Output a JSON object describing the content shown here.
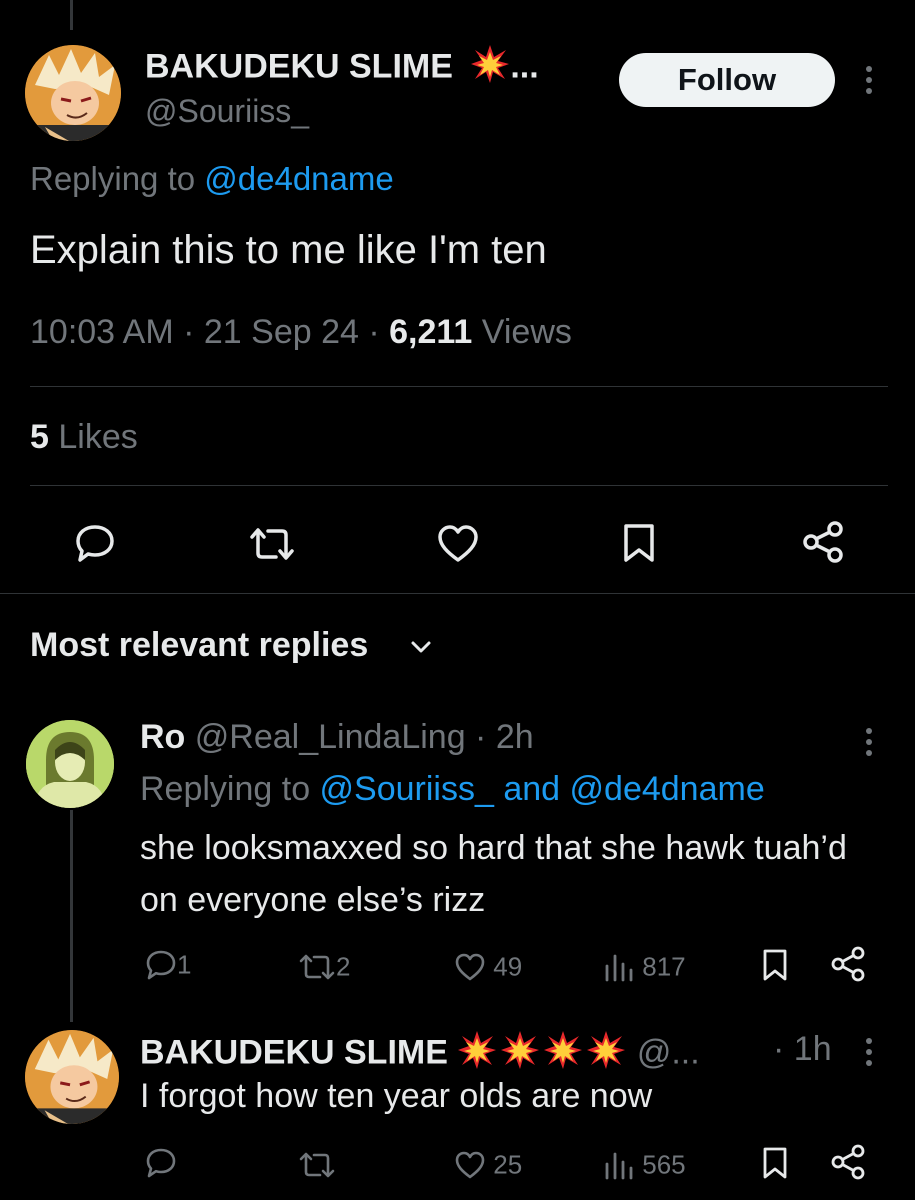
{
  "main_tweet": {
    "author_name": "BAKUDEKU SLIME",
    "name_overflow": "...",
    "author_handle": "@Souriiss_",
    "follow_label": "Follow",
    "replying_prefix": "Replying to ",
    "replying_to": "@de4dname",
    "text": "Explain this to me like I'm ten",
    "time": "10:03 AM",
    "separator": " · ",
    "date": "21 Sep 24",
    "views_count": "6,211",
    "views_label": " Views",
    "likes_count": "5",
    "likes_label": " Likes"
  },
  "actions": {
    "reply_icon": "reply-icon",
    "retweet_icon": "retweet-icon",
    "like_icon": "heart-icon",
    "bookmark_icon": "bookmark-icon",
    "share_icon": "share-icon"
  },
  "replies_section": {
    "title": "Most relevant replies"
  },
  "replies": [
    {
      "name": "Ro",
      "handle": "@Real_LindaLing",
      "time": "2h",
      "replying_prefix": "Replying to ",
      "replying_to_1": "@Souriiss_",
      "replying_and": " and ",
      "replying_to_2": "@de4dname",
      "text": "she looksmaxxed so hard that she hawk tuah’d on everyone else’s rizz",
      "reply_count": "1",
      "retweet_count": "2",
      "like_count": "49",
      "view_count": "817"
    },
    {
      "name": "BAKUDEKU SLIME",
      "handle": "@...",
      "time": "1h",
      "text": "I forgot how ten year olds are now",
      "reply_count": "",
      "retweet_count": "",
      "like_count": "25",
      "view_count": "565"
    }
  ],
  "colors": {
    "background": "#000000",
    "text": "#e7e9ea",
    "muted": "#71767b",
    "link": "#1d9bf0",
    "divider": "#2f3336"
  }
}
